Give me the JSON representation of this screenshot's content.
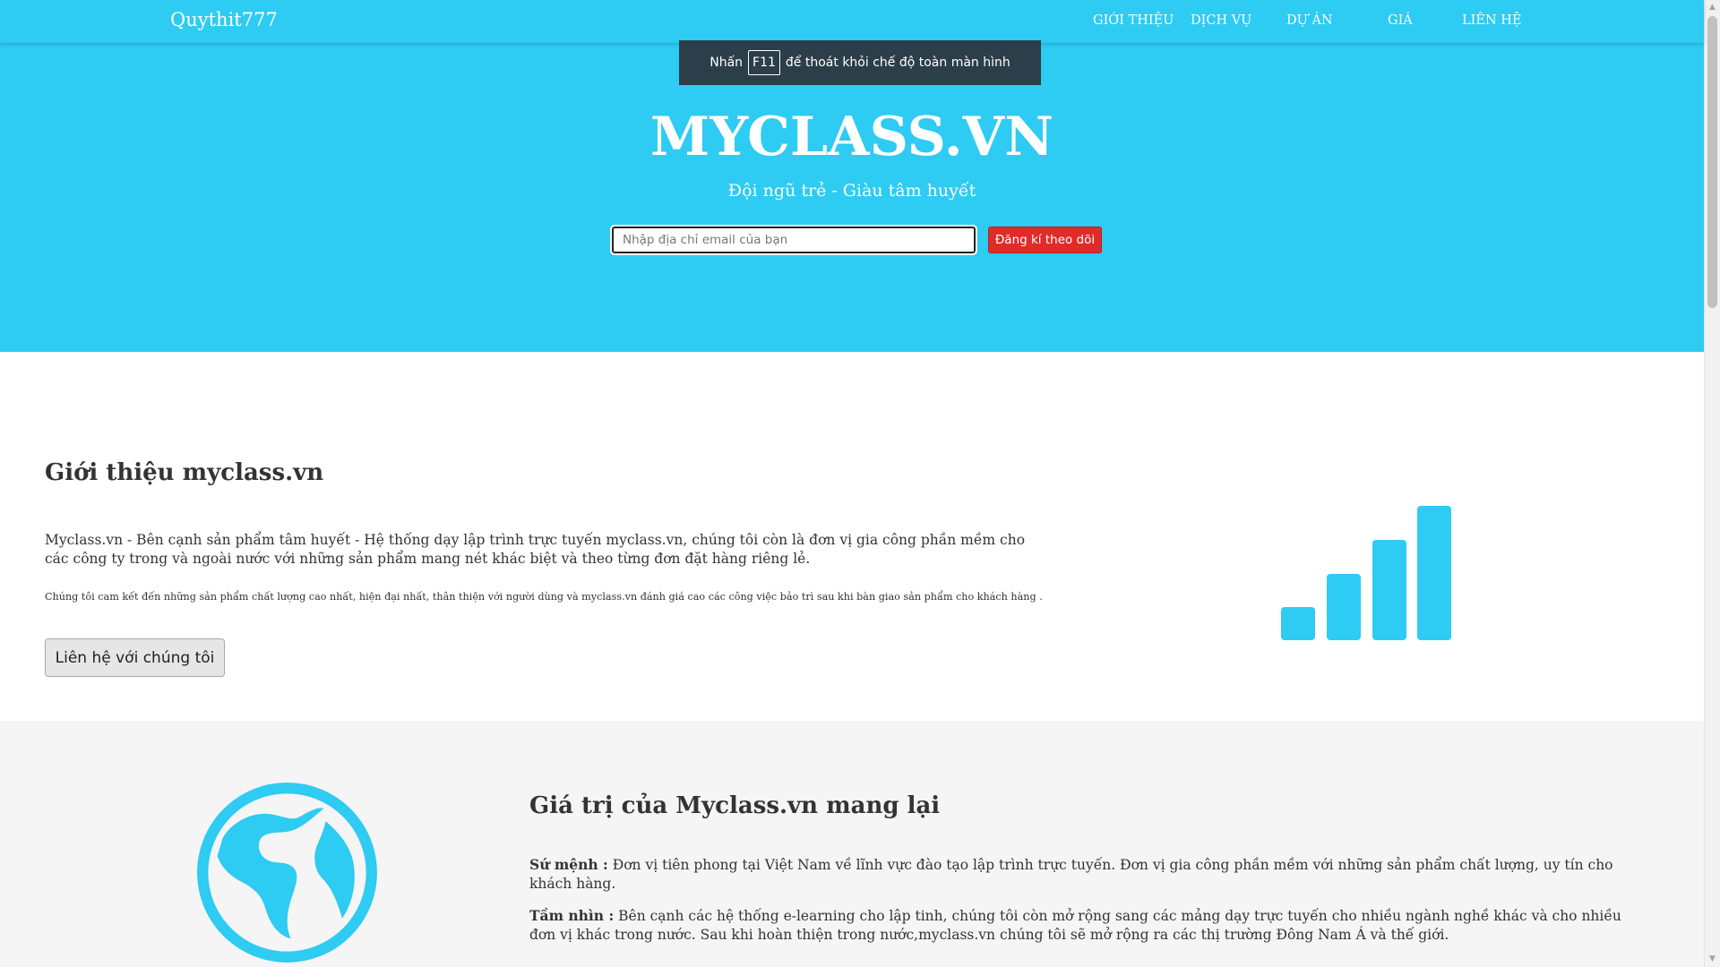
{
  "navbar": {
    "brand": "Quythit777",
    "items": [
      "GIỚI THIỆU",
      "DỊCH VỤ",
      "DỰ ÁN",
      "GIÁ",
      "LIÊN HỆ"
    ]
  },
  "fullscreen_notice": {
    "before": "Nhấn",
    "key": "F11",
    "after": "để thoát khỏi chế độ toàn màn hình"
  },
  "hero": {
    "title": "MYCLASS.VN",
    "subtitle": "Đội ngũ trẻ - Giàu tâm huyết",
    "email_placeholder": "Nhập địa chỉ email của bạn",
    "subscribe_label": "Đăng kí theo dõi"
  },
  "intro": {
    "title": "Giới thiệu myclass.vn",
    "paragraph1": "Myclass.vn - Bên cạnh sản phẩm tâm huyết - Hệ thống dạy lập trình trực tuyến myclass.vn, chúng tôi còn là đơn vị gia công phần mềm cho các công ty trong và ngoài nước với những sản phẩm mang nét khác biệt và theo từng đơn đặt hàng riêng lẻ.",
    "paragraph2": "Chúng tôi cam kết đến những sản phẩm chất lượng cao nhất, hiện đại nhất, thân thiện với người dùng và myclass.vn đánh giá cao các công việc bảo trì sau khi bàn giao sản phẩm cho khách hàng .",
    "contact_button": "Liên hệ với chúng tôi",
    "icon": "signal-bars-icon"
  },
  "values": {
    "title": "Giá trị của Myclass.vn mang lại",
    "mission_label": "Sứ mệnh :",
    "mission_text": "Đơn vị tiên phong tại Việt Nam về lĩnh vực đào tạo lập trình trực tuyến. Đơn vị gia công phần mềm với những sản phẩm chất lượng, uy tín cho khách hàng.",
    "vision_label": "Tầm nhìn :",
    "vision_text": "Bên cạnh các hệ thống e-learning cho lập tinh, chúng tôi còn mở rộng sang các mảng dạy trực tuyến cho nhiều ngành nghề khác và cho nhiều đơn vị khác trong nước. Sau khi hoàn thiện trong nước,myclass.vn chúng tôi sẽ mở rộng ra các thị trường Đông Nam Á và thế giới.",
    "icon": "globe-icon"
  },
  "colors": {
    "primary": "#2ecbf2",
    "accent_red": "#e02b2b",
    "notice_bg": "#2c3e4a"
  }
}
